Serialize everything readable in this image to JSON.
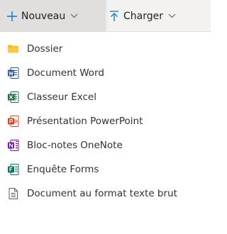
{
  "toolbar": {
    "new_label": "Nouveau",
    "upload_label": "Charger",
    "new_icon": "plus-icon",
    "upload_icon": "upload-arrow-icon"
  },
  "menu": {
    "items": [
      {
        "label": "Dossier",
        "icon": "folder-icon",
        "color": "#ffb900"
      },
      {
        "label": "Document Word",
        "icon": "word-icon",
        "color": "#2b579a"
      },
      {
        "label": "Classeur Excel",
        "icon": "excel-icon",
        "color": "#217346"
      },
      {
        "label": "Présentation PowerPoint",
        "icon": "powerpoint-icon",
        "color": "#d24726"
      },
      {
        "label": "Bloc-notes OneNote",
        "icon": "onenote-icon",
        "color": "#7719aa"
      },
      {
        "label": "Enquête Forms",
        "icon": "forms-icon",
        "color": "#077568"
      },
      {
        "label": "Document au format texte brut",
        "icon": "text-file-icon",
        "color": "#605e5c"
      }
    ]
  },
  "colors": {
    "accent": "#0078d4",
    "toolbar_bg": "#f3f2f1",
    "new_button_bg": "#e1dfdd"
  }
}
